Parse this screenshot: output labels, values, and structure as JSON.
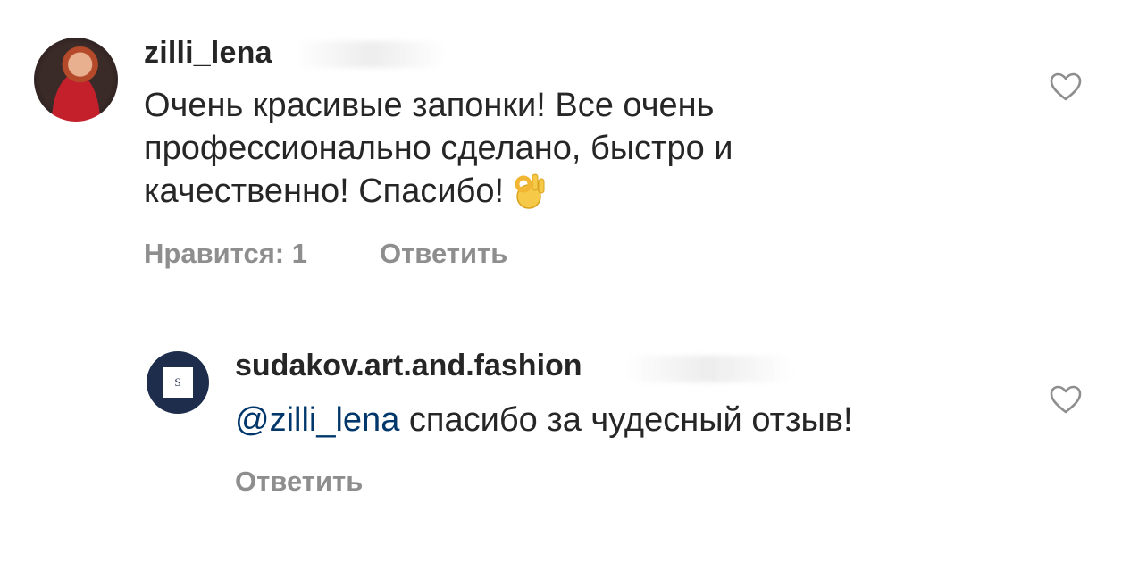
{
  "comments": [
    {
      "username": "zilli_lena",
      "text": "Очень красивые запонки! Все очень профессионально сделано, быстро и качественно!  Спасибо!",
      "emoji": "ok-hand",
      "likes_label": "Нравится: 1",
      "reply_label": "Ответить",
      "avatar_icon": "profile-photo"
    },
    {
      "username": "sudakov.art.and.fashion",
      "mention": "@zilli_lena",
      "text": "спасибо за чудесный отзыв!",
      "reply_label": "Ответить",
      "avatar_letter": "S"
    }
  ],
  "colors": {
    "text": "#262626",
    "meta": "#8e8e8e",
    "mention": "#00376b",
    "avatar_brand": "#1f2d4d"
  }
}
